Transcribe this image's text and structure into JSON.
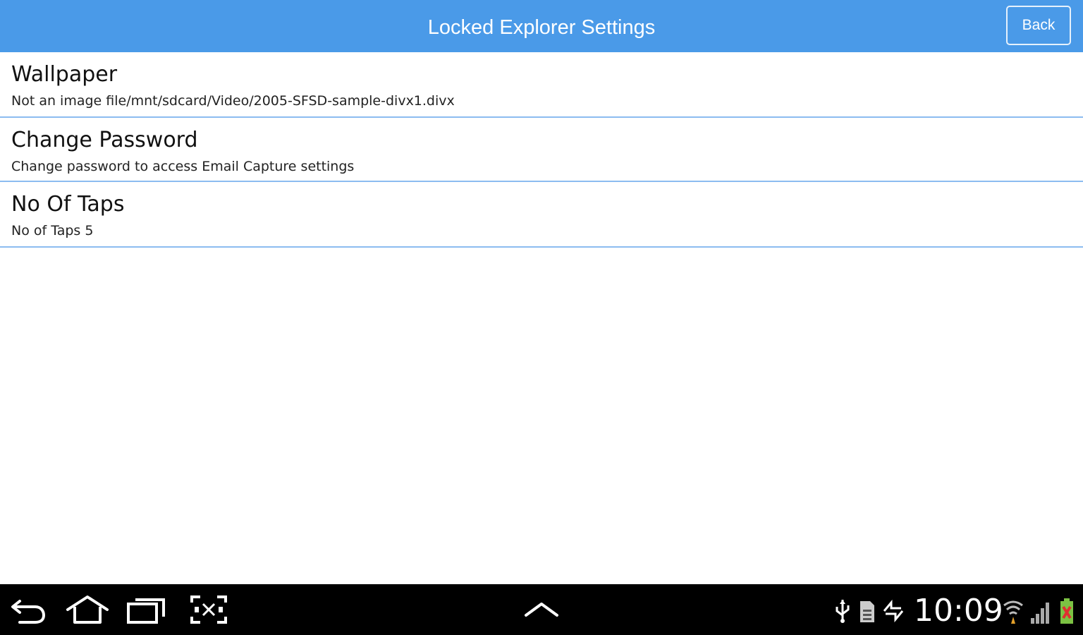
{
  "header": {
    "title": "Locked Explorer Settings",
    "back_label": "Back",
    "background": "#4a9ae8"
  },
  "settings": [
    {
      "title": "Wallpaper",
      "summary": "Not an image file/mnt/sdcard/Video/2005-SFSD-sample-divx1.divx"
    },
    {
      "title": "Change Password",
      "summary": "Change password to access Email Capture settings"
    },
    {
      "title": "No Of Taps",
      "summary": "No of Taps 5"
    }
  ],
  "divider_color": "#8cbcf0",
  "system_bar": {
    "time": "10:09",
    "icons": [
      "back-icon",
      "home-icon",
      "recent-apps-icon",
      "screenshot-icon",
      "chevron-up-icon",
      "usb-icon",
      "sd-card-icon",
      "sync-icon",
      "wifi-icon",
      "signal-icon",
      "battery-icon"
    ]
  }
}
